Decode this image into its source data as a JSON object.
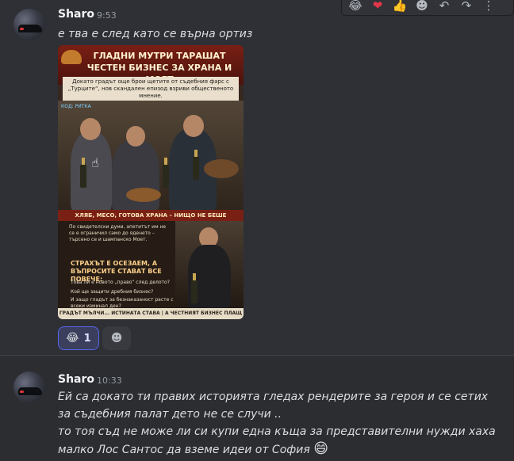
{
  "toolbar": {
    "emojis": [
      "😂",
      "❤️",
      "👍"
    ],
    "icons": [
      "add-reaction-icon",
      "reply-icon",
      "forward-icon",
      "more-icon"
    ]
  },
  "message1": {
    "author": "Sharo",
    "time": "9:53",
    "text": "е тва е след като се върна ортиз",
    "poster": {
      "title": "ГЛАДНИ МУТРИ ТАРАШАТ ЧЕСТЕН БИЗНЕС ЗА ХРАНА И МОЕТ",
      "subtitle": "Докато градът още брои щетите от съдебния фарс с „Турците“, нов скандален епизод взриви общественото мнение.",
      "code": "КОД: РИТКА",
      "banner": "ХЛЯБ, МЕСО, ГОТОВА ХРАНА – НИЩО НЕ БЕШЕ ПОМИНАТО.",
      "left_text": "По свидетелски думи, апетитът им не се е ограничил само до яденето – търсено се и шампанско Моет.",
      "fear_title": "СТРАХЪТ Е ОСЕЗАЕМ, А ВЪПРОСИТЕ СТАВАТ ВСЕ ПОВЕЧЕ:",
      "q1": "Това ли е новото „право“ след делото?",
      "q2": "Кой ще защити дребния бизнес?",
      "q3": "И защо гладът за безнаказаност расте с всеки изминал ден?",
      "footer": "ГРАДЪТ МЪЛЧИ... ИСТИНАТА СТАВА | А ЧЕСТНИЯТ БИЗНЕС ПЛАЩ"
    },
    "reaction": {
      "emoji": "😂",
      "count": "1"
    }
  },
  "message2": {
    "author": "Sharo",
    "time": "10:33",
    "lines": [
      "Ей са докато ти правих историята гледах рендерите за героя и  се сетих",
      "за съдебния палат  дето не се случи ..",
      "то тоя съд не може ли си купи една  къща за представителни нужди хаха",
      "малко Лос Сантос да вземе идеи от София"
    ],
    "trailing_emoji": "😄"
  }
}
